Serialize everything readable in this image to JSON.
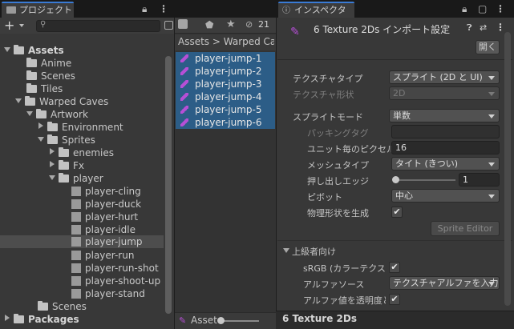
{
  "project": {
    "tab": "プロジェクト",
    "add_button": "+",
    "search_placeholder": "",
    "tree": [
      {
        "label": "Assets",
        "depth": 0,
        "expanded": true,
        "bold": true
      },
      {
        "label": "Anime",
        "depth": 1,
        "expanded": null
      },
      {
        "label": "Scenes",
        "depth": 1,
        "expanded": null
      },
      {
        "label": "Tiles",
        "depth": 1,
        "expanded": null
      },
      {
        "label": "Warped Caves",
        "depth": 1,
        "expanded": true
      },
      {
        "label": "Artwork",
        "depth": 2,
        "expanded": true
      },
      {
        "label": "Environment",
        "depth": 3,
        "expanded": false
      },
      {
        "label": "Sprites",
        "depth": 3,
        "expanded": true
      },
      {
        "label": "enemies",
        "depth": 4,
        "expanded": false
      },
      {
        "label": "Fx",
        "depth": 4,
        "expanded": false
      },
      {
        "label": "player",
        "depth": 4,
        "expanded": true
      },
      {
        "label": "player-cling",
        "depth": 5,
        "expanded": null
      },
      {
        "label": "player-duck",
        "depth": 5,
        "expanded": null
      },
      {
        "label": "player-hurt",
        "depth": 5,
        "expanded": null
      },
      {
        "label": "player-idle",
        "depth": 5,
        "expanded": null
      },
      {
        "label": "player-jump",
        "depth": 5,
        "expanded": null,
        "selected": true
      },
      {
        "label": "player-run",
        "depth": 5,
        "expanded": null
      },
      {
        "label": "player-run-shot",
        "depth": 5,
        "expanded": null
      },
      {
        "label": "player-shoot-up",
        "depth": 5,
        "expanded": null
      },
      {
        "label": "player-stand",
        "depth": 5,
        "expanded": null
      },
      {
        "label": "Scenes",
        "depth": 2,
        "expanded": null
      },
      {
        "label": "Packages",
        "depth": 0,
        "expanded": false,
        "bold": true
      }
    ]
  },
  "assets": {
    "breadcrumb": "Assets  >  Warped Cav",
    "hidden_count": "21",
    "items": [
      "player-jump-1",
      "player-jump-2",
      "player-jump-3",
      "player-jump-4",
      "player-jump-5",
      "player-jump-6"
    ],
    "footer": "Asset"
  },
  "inspector": {
    "tab": "インスペクター",
    "title": "6 Texture 2Ds インポート設定",
    "open_button": "開く",
    "texture_type_label": "テクスチャタイプ",
    "texture_type_value": "スプライト (2D と UI)",
    "texture_shape_label": "テクスチャ形状",
    "texture_shape_value": "2D",
    "sprite_mode_label": "スプライトモード",
    "sprite_mode_value": "単数",
    "packing_tag_label": "パッキングタグ",
    "packing_tag_value": "",
    "ppu_label": "ユニット毎のピクセル数",
    "ppu_value": "16",
    "mesh_type_label": "メッシュタイプ",
    "mesh_type_value": "タイト (きつい)",
    "extrude_label": "押し出しエッジ",
    "extrude_value": "1",
    "pivot_label": "ピボット",
    "pivot_value": "中心",
    "physics_label": "物理形状を生成",
    "physics_checked": true,
    "sprite_editor_button": "Sprite Editor",
    "advanced_label": "上級者向け",
    "srgb_label": "sRGB (カラーテクスチャ",
    "srgb_checked": true,
    "alpha_source_label": "アルファソース",
    "alpha_source_value": "テクスチャアルファを入力",
    "alpha_transparency_label": "アルファ値を透明度とし",
    "alpha_transparency_checked": true,
    "footer_title": "6 Texture 2Ds"
  }
}
